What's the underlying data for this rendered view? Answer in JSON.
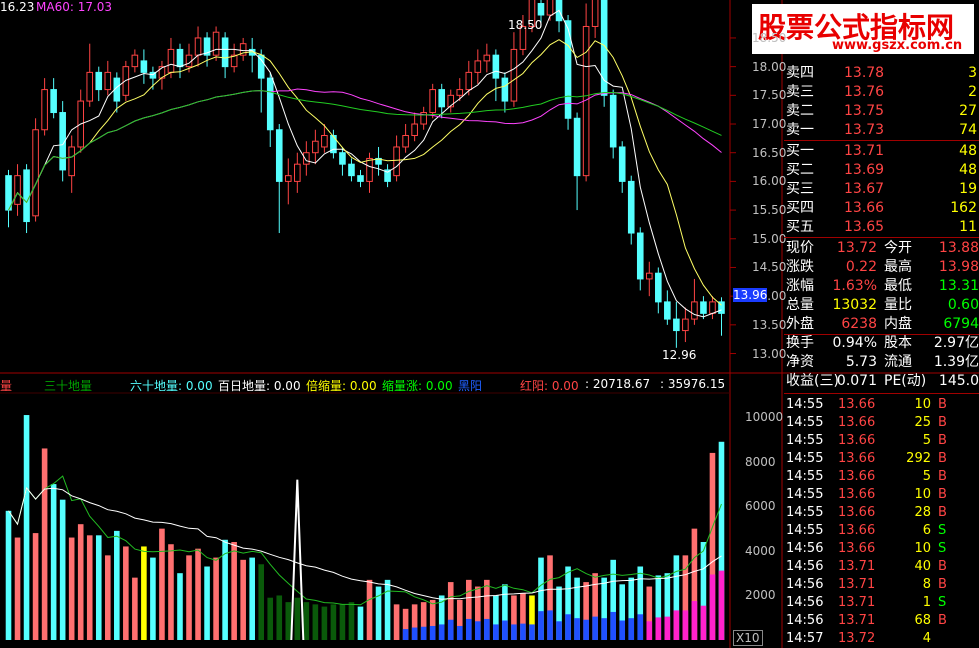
{
  "header": {
    "ma_label_1": "16.23",
    "ma_label_2": "MA60: 17.03"
  },
  "watermark": {
    "line1": "股票公式指标网",
    "line2": "www.gszx.com.cn"
  },
  "price_axis": {
    "ticks": [
      "18.50",
      "18.00",
      "17.50",
      "17.00",
      "16.50",
      "16.00",
      "15.50",
      "15.00",
      "14.50",
      "14.00",
      "13.50",
      "13.00"
    ],
    "current_tag": "13.96",
    "high_marker": "18.50",
    "low_marker": "12.96"
  },
  "volume_axis": {
    "ticks": [
      "10000",
      "8000",
      "6000",
      "4000",
      "2000"
    ],
    "multiplier": "X10"
  },
  "indicator_bar": {
    "items": [
      {
        "label": "量",
        "color": "#ff4444"
      },
      {
        "label": "三十地量",
        "color": "#00a000"
      },
      {
        "label": "六十地量: 0.00",
        "color": "#55ffff"
      },
      {
        "label": "百日地量: 0.00",
        "color": "#ffffff"
      },
      {
        "label": "倍缩量: 0.00",
        "color": "#ffff00"
      },
      {
        "label": "缩量涨: 0.00",
        "color": "#00ff00"
      },
      {
        "label": "黑阳",
        "color": "#2060ff"
      },
      {
        "label": "红阳: 0.00",
        "color": "#ff4444"
      },
      {
        "label": ": 20718.67",
        "color": "#ffffff"
      },
      {
        "label": ": 35976.15",
        "color": "#ffffff"
      }
    ]
  },
  "orderbook": {
    "sells": [
      {
        "label": "卖四",
        "price": "13.78",
        "vol": "3"
      },
      {
        "label": "卖三",
        "price": "13.76",
        "vol": "2"
      },
      {
        "label": "卖二",
        "price": "13.75",
        "vol": "27"
      },
      {
        "label": "卖一",
        "price": "13.73",
        "vol": "74"
      }
    ],
    "buys": [
      {
        "label": "买一",
        "price": "13.71",
        "vol": "48"
      },
      {
        "label": "买二",
        "price": "13.69",
        "vol": "48"
      },
      {
        "label": "买三",
        "price": "13.67",
        "vol": "19"
      },
      {
        "label": "买四",
        "price": "13.66",
        "vol": "162"
      },
      {
        "label": "买五",
        "price": "13.65",
        "vol": "11"
      }
    ]
  },
  "quote": {
    "rows": [
      {
        "k1": "现价",
        "v1": "13.72",
        "k2": "今开",
        "v2": "13.88",
        "c1": "#ff4444",
        "c2": "#ff4444"
      },
      {
        "k1": "涨跌",
        "v1": "0.22",
        "k2": "最高",
        "v2": "13.98",
        "c1": "#ff4444",
        "c2": "#ff4444"
      },
      {
        "k1": "涨幅",
        "v1": "1.63%",
        "k2": "最低",
        "v2": "13.31",
        "c1": "#ff4444",
        "c2": "#00ff00"
      },
      {
        "k1": "总量",
        "v1": "13032",
        "k2": "量比",
        "v2": "0.60",
        "c1": "#ffff00",
        "c2": "#00ff00"
      },
      {
        "k1": "外盘",
        "v1": "6238",
        "k2": "内盘",
        "v2": "6794",
        "c1": "#ff4444",
        "c2": "#00ff00"
      },
      {
        "k1": "换手",
        "v1": "0.94%",
        "k2": "股本",
        "v2": "2.97亿",
        "c1": "#ffffff",
        "c2": "#ffffff"
      },
      {
        "k1": "净资",
        "v1": "5.73",
        "k2": "流通",
        "v2": "1.39亿",
        "c1": "#ffffff",
        "c2": "#ffffff"
      },
      {
        "k1": "收益(三)",
        "v1": "0.071",
        "k2": "PE(动)",
        "v2": "145.0",
        "c1": "#ffffff",
        "c2": "#ffffff"
      }
    ]
  },
  "ticks": [
    {
      "time": "14:55",
      "price": "13.66",
      "vol": "10",
      "side": "B"
    },
    {
      "time": "14:55",
      "price": "13.66",
      "vol": "25",
      "side": "B"
    },
    {
      "time": "14:55",
      "price": "13.66",
      "vol": "5",
      "side": "B"
    },
    {
      "time": "14:55",
      "price": "13.66",
      "vol": "292",
      "side": "B"
    },
    {
      "time": "14:55",
      "price": "13.66",
      "vol": "5",
      "side": "B"
    },
    {
      "time": "14:55",
      "price": "13.66",
      "vol": "10",
      "side": "B"
    },
    {
      "time": "14:55",
      "price": "13.66",
      "vol": "28",
      "side": "B"
    },
    {
      "time": "14:55",
      "price": "13.66",
      "vol": "6",
      "side": "S"
    },
    {
      "time": "14:56",
      "price": "13.66",
      "vol": "10",
      "side": "S"
    },
    {
      "time": "14:56",
      "price": "13.71",
      "vol": "40",
      "side": "B"
    },
    {
      "time": "14:56",
      "price": "13.71",
      "vol": "8",
      "side": "B"
    },
    {
      "time": "14:56",
      "price": "13.71",
      "vol": "1",
      "side": "S"
    },
    {
      "time": "14:56",
      "price": "13.71",
      "vol": "68",
      "side": "B"
    },
    {
      "time": "14:57",
      "price": "13.72",
      "vol": "4",
      "side": ""
    }
  ],
  "chart_data": {
    "type": "candlestick",
    "price_range": [
      12.8,
      18.9
    ],
    "volume_range": [
      0,
      11000
    ],
    "candles": [
      [
        16.1,
        15.5,
        16.2,
        15.2
      ],
      [
        15.6,
        16.1,
        16.3,
        15.4
      ],
      [
        16.2,
        15.3,
        16.3,
        15.1
      ],
      [
        15.4,
        16.9,
        17.1,
        15.3
      ],
      [
        16.9,
        17.6,
        17.8,
        16.8
      ],
      [
        17.6,
        17.2,
        17.8,
        17.1
      ],
      [
        17.2,
        16.2,
        17.4,
        16.0
      ],
      [
        16.1,
        16.6,
        16.8,
        15.8
      ],
      [
        16.6,
        17.4,
        17.6,
        16.5
      ],
      [
        17.4,
        17.9,
        18.4,
        17.3
      ],
      [
        17.9,
        17.6,
        18.0,
        17.4
      ],
      [
        17.6,
        17.9,
        18.1,
        17.5
      ],
      [
        17.8,
        17.4,
        17.9,
        17.2
      ],
      [
        17.5,
        18.0,
        18.1,
        17.4
      ],
      [
        18.0,
        18.2,
        18.3,
        17.9
      ],
      [
        18.1,
        17.9,
        18.3,
        17.7
      ],
      [
        17.9,
        17.8,
        18.0,
        17.6
      ],
      [
        17.8,
        18.0,
        18.1,
        17.6
      ],
      [
        17.9,
        18.3,
        18.5,
        17.8
      ],
      [
        18.3,
        18.0,
        18.4,
        17.8
      ],
      [
        18.0,
        18.2,
        18.4,
        17.9
      ],
      [
        18.2,
        18.5,
        18.7,
        18.0
      ],
      [
        18.5,
        18.2,
        18.6,
        18.0
      ],
      [
        18.2,
        18.6,
        18.7,
        18.1
      ],
      [
        18.5,
        18.0,
        18.6,
        17.8
      ],
      [
        18.0,
        18.2,
        18.4,
        17.9
      ],
      [
        18.2,
        18.4,
        18.5,
        18.1
      ],
      [
        18.3,
        18.2,
        18.5,
        17.9
      ],
      [
        18.2,
        17.8,
        18.3,
        17.2
      ],
      [
        17.8,
        16.9,
        17.9,
        16.6
      ],
      [
        16.9,
        16.0,
        17.0,
        15.1
      ],
      [
        16.0,
        16.1,
        16.4,
        15.6
      ],
      [
        16.0,
        16.3,
        16.5,
        15.8
      ],
      [
        16.3,
        16.5,
        16.7,
        16.1
      ],
      [
        16.5,
        16.7,
        16.9,
        16.3
      ],
      [
        16.6,
        16.8,
        17.0,
        16.5
      ],
      [
        16.8,
        16.5,
        16.9,
        16.4
      ],
      [
        16.5,
        16.3,
        16.6,
        16.1
      ],
      [
        16.3,
        16.1,
        16.4,
        16.0
      ],
      [
        16.1,
        16.0,
        16.2,
        15.9
      ],
      [
        16.0,
        16.4,
        16.5,
        15.8
      ],
      [
        16.4,
        16.3,
        16.6,
        16.1
      ],
      [
        16.2,
        16.0,
        16.3,
        15.9
      ],
      [
        16.1,
        16.6,
        16.8,
        16.0
      ],
      [
        16.6,
        16.8,
        17.0,
        16.5
      ],
      [
        16.8,
        17.0,
        17.2,
        16.7
      ],
      [
        17.0,
        17.2,
        17.3,
        16.9
      ],
      [
        17.2,
        17.6,
        17.7,
        17.1
      ],
      [
        17.6,
        17.3,
        17.7,
        17.1
      ],
      [
        17.3,
        17.5,
        17.6,
        17.2
      ],
      [
        17.5,
        17.6,
        17.8,
        17.4
      ],
      [
        17.6,
        17.9,
        18.1,
        17.5
      ],
      [
        17.9,
        18.1,
        18.3,
        17.7
      ],
      [
        18.1,
        18.2,
        18.4,
        17.9
      ],
      [
        18.2,
        17.8,
        18.3,
        17.4
      ],
      [
        17.8,
        17.4,
        17.9,
        17.2
      ],
      [
        17.4,
        18.3,
        18.6,
        17.3
      ],
      [
        18.3,
        18.7,
        18.9,
        18.2
      ],
      [
        18.7,
        19.2,
        19.4,
        18.6
      ],
      [
        19.1,
        18.9,
        19.3,
        18.7
      ],
      [
        18.9,
        19.3,
        19.4,
        18.8
      ],
      [
        19.2,
        18.8,
        19.3,
        18.6
      ],
      [
        18.8,
        17.1,
        18.9,
        16.9
      ],
      [
        17.1,
        16.1,
        17.2,
        15.5
      ],
      [
        16.1,
        18.7,
        19.1,
        16.0
      ],
      [
        18.7,
        19.4,
        19.5,
        18.5
      ],
      [
        19.4,
        17.5,
        19.5,
        17.3
      ],
      [
        17.5,
        16.6,
        17.6,
        16.4
      ],
      [
        16.6,
        16.0,
        16.7,
        15.8
      ],
      [
        16.0,
        15.1,
        16.1,
        14.9
      ],
      [
        15.1,
        14.3,
        15.2,
        14.1
      ],
      [
        14.3,
        14.4,
        14.6,
        14.0
      ],
      [
        14.4,
        13.9,
        14.5,
        13.7
      ],
      [
        13.9,
        13.6,
        14.1,
        13.5
      ],
      [
        13.6,
        13.4,
        13.9,
        13.1
      ],
      [
        13.4,
        13.6,
        13.8,
        13.2
      ],
      [
        13.6,
        13.9,
        14.3,
        13.5
      ],
      [
        13.9,
        13.7,
        14.0,
        13.6
      ],
      [
        13.7,
        13.9,
        14.0,
        13.6
      ],
      [
        13.9,
        13.7,
        13.98,
        13.31
      ]
    ],
    "volumes": [
      5800,
      4600,
      10100,
      4800,
      8600,
      7000,
      6300,
      4600,
      5200,
      4700,
      4700,
      3800,
      4900,
      4200,
      2800,
      4200,
      3700,
      5000,
      4300,
      3000,
      3800,
      4100,
      3300,
      3700,
      4500,
      4400,
      3600,
      3700,
      3400,
      1900,
      2000,
      1700,
      1900,
      1700,
      1600,
      1500,
      1600,
      1600,
      1700,
      1500,
      2700,
      2400,
      2700,
      1600,
      1400,
      1600,
      1700,
      1800,
      2000,
      2600,
      1800,
      2700,
      2400,
      2700,
      2000,
      2500,
      2000,
      2100,
      2000,
      3700,
      3800,
      2400,
      3300,
      2800,
      2600,
      3000,
      2800,
      3600,
      2500,
      2800,
      3300,
      2400,
      2900,
      3000,
      3800,
      3800,
      5000,
      4400,
      8400,
      8900
    ],
    "ma5_label": "16.23",
    "ma60_label": "MA60: 17.03"
  }
}
